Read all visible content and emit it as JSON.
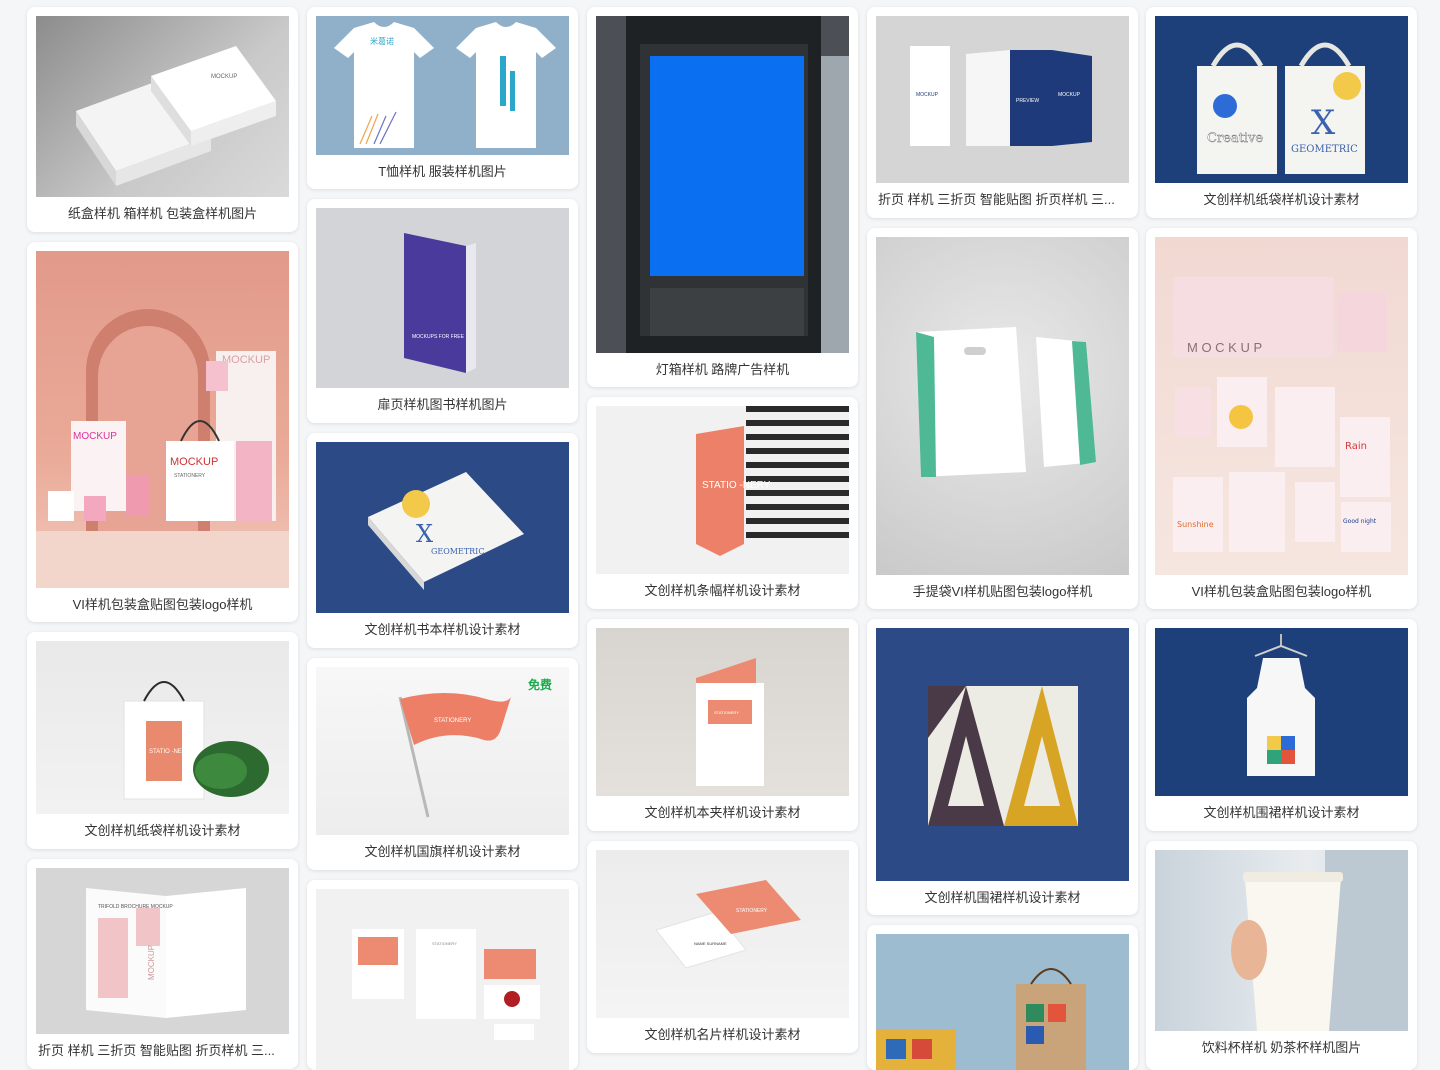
{
  "cards": [
    {
      "caption": "纸盒样机 箱样机 包装盒样机图片"
    },
    {
      "caption": "VI样机包装盒贴图包装logo样机"
    },
    {
      "caption": "文创样机纸袋样机设计素材"
    },
    {
      "caption": "折页 样机 三折页 智能贴图 折页样机 三..."
    },
    {
      "caption": "T恤样机 服装样机图片"
    },
    {
      "caption": "扉页样机图书样机图片"
    },
    {
      "caption": "文创样机书本样机设计素材"
    },
    {
      "caption": "文创样机国旗样机设计素材",
      "badge": "免费"
    },
    {
      "caption": ""
    },
    {
      "caption": "灯箱样机 路牌广告样机"
    },
    {
      "caption": "文创样机条幅样机设计素材"
    },
    {
      "caption": "文创样机本夹样机设计素材"
    },
    {
      "caption": "文创样机名片样机设计素材"
    },
    {
      "caption": "折页 样机 三折页 智能贴图 折页样机 三..."
    },
    {
      "caption": "手提袋VI样机贴图包装logo样机"
    },
    {
      "caption": "文创样机围裙样机设计素材"
    },
    {
      "caption": ""
    },
    {
      "caption": "文创样机纸袋样机设计素材"
    },
    {
      "caption": "VI样机包装盒贴图包装logo样机"
    },
    {
      "caption": "文创样机围裙样机设计素材"
    },
    {
      "caption": "饮料杯样机 奶茶杯样机图片"
    }
  ],
  "thumb_text": {
    "box_lid": "MOCKUP",
    "mockup_sign": "MOCKUP",
    "bag_a": "MOCKUP",
    "bag_b": "MOCKUP",
    "bag_sub": "STATIONERY",
    "stationery_tag": "STATIO -NERY",
    "brochure_title": "TRIFOLD BROCHURE MOCKUP",
    "brochure_side": "MOCKUP",
    "tee_print": "米葛诺",
    "book_cover": "MOCKUPS FOR FREE",
    "geo_x": "X",
    "geo_word": "GEOMETRIC",
    "flag_text": "STATIONERY",
    "sheet_logo": "STATIONERY",
    "banner_text": "STATIO -NERY",
    "folder_label": "STATIONERY",
    "card_text": "STATIONERY",
    "card_name": "NAME SURNAME",
    "fold_left": "MOCKUP",
    "fold_mid": "PREVIEW",
    "fold_right": "MOCKUP",
    "tote_word": "Creative",
    "tote_x": "X",
    "tote_geo": "GEOMETRIC",
    "wall_mockup": "M O C K U P",
    "rain_text": "Rain",
    "night_text": "Good night",
    "sun_text": "Sunshine"
  },
  "colors": {
    "page_bg": "#f5f6f8",
    "caption_text": "#333333",
    "free_badge": "#1aad4b",
    "lightbox_blue": "#0a6ff0",
    "navy": "#2b4b88",
    "coral": "#e8826a"
  }
}
